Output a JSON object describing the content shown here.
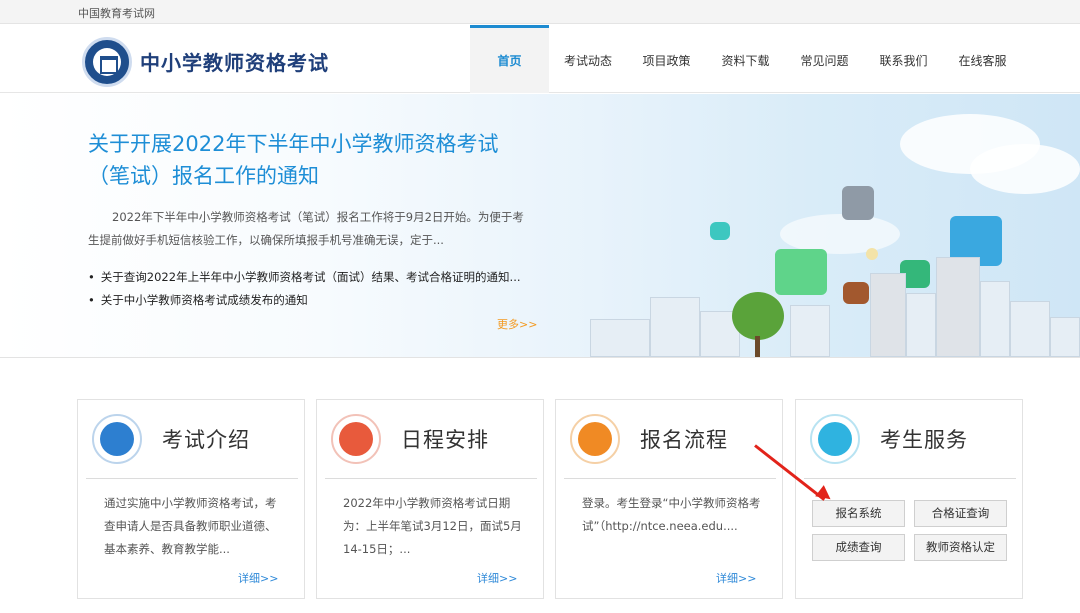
{
  "topbar": {
    "site_name": "中国教育考试网"
  },
  "header": {
    "title": "中小学教师资格考试",
    "nav": [
      "首页",
      "考试动态",
      "项目政策",
      "资料下载",
      "常见问题",
      "联系我们",
      "在线客服"
    ],
    "active_index": 0
  },
  "banner": {
    "title": "关于开展2022年下半年中小学教师资格考试（笔试）报名工作的通知",
    "summary": "2022年下半年中小学教师资格考试（笔试）报名工作将于9月2日开始。为便于考生提前做好手机短信核验工作，以确保所填报手机号准确无误，定于...",
    "list": [
      "关于查询2022年上半年中小学教师资格考试（面试）结果、考试合格证明的通知...",
      "关于中小学教师资格考试成绩发布的通知"
    ],
    "more": "更多>>"
  },
  "cards": {
    "intro": {
      "title": "考试介绍",
      "text": "通过实施中小学教师资格考试，考查申请人是否具备教师职业道德、基本素养、教育教学能...",
      "detail": "详细>>"
    },
    "schedule": {
      "title": "日程安排",
      "text": "2022年中小学教师资格考试日期为：上半年笔试3月12日，面试5月14-15日；...",
      "detail": "详细>>"
    },
    "process": {
      "title": "报名流程",
      "text": "登录。考生登录“中小学教师资格考试”（http://ntce.neea.edu....",
      "detail": "详细>>"
    },
    "services": {
      "title": "考生服务",
      "buttons": [
        "报名系统",
        "合格证查询",
        "成绩查询",
        "教师资格认定"
      ]
    }
  },
  "colors": {
    "brand_blue": "#1e8ed6",
    "nav_active": "#1d8bd1",
    "more_orange": "#f39a21",
    "detail_blue": "#2e89d8",
    "annotation_red": "#e2231a"
  },
  "icons": {
    "intro": "document-pen-icon",
    "schedule": "checkmark-icon",
    "process": "form-pen-icon",
    "services": "contacts-book-icon"
  }
}
